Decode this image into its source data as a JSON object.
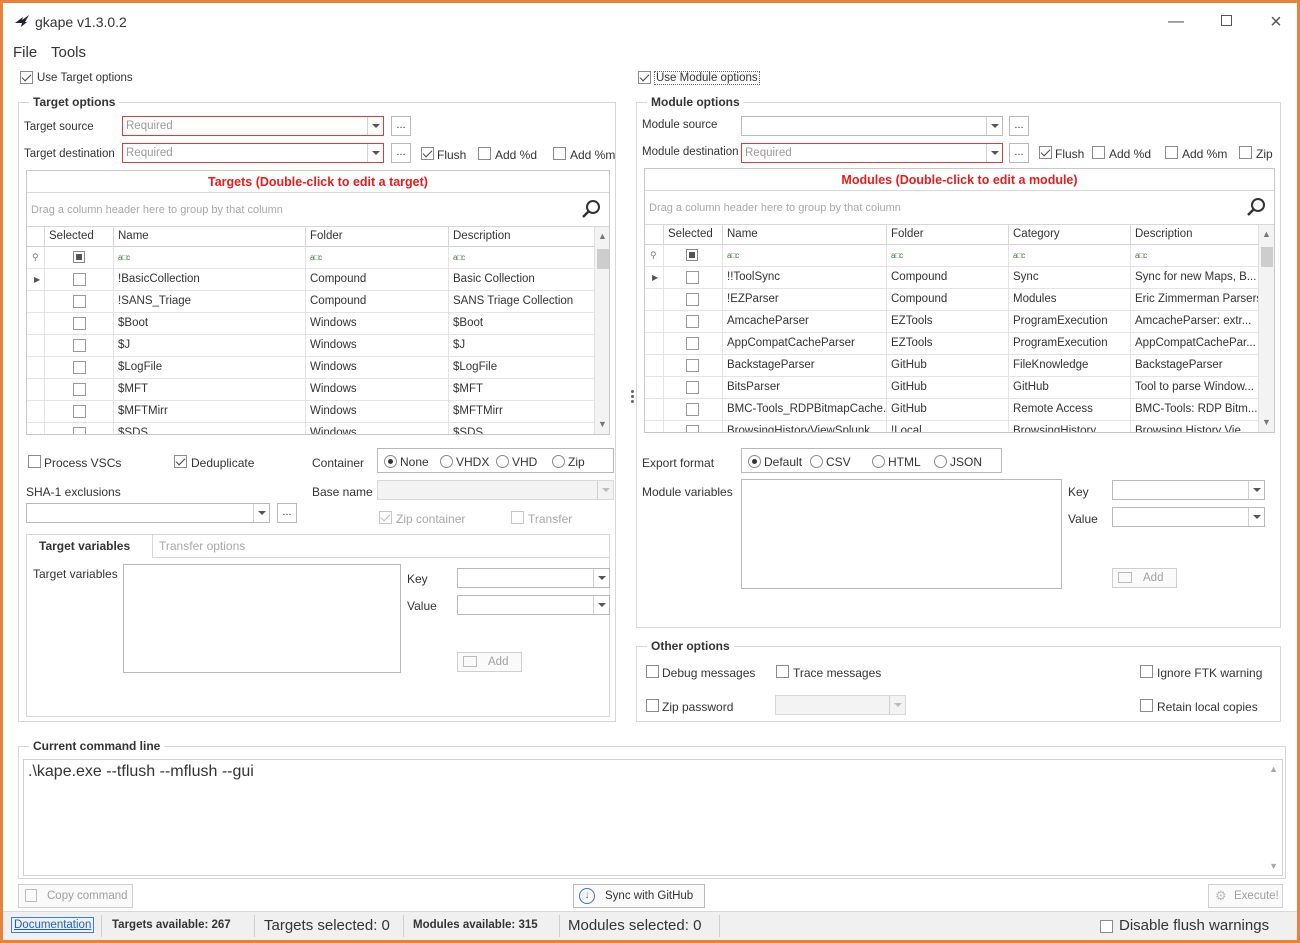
{
  "app": {
    "title": "gkape v1.3.0.2"
  },
  "menu": [
    "File",
    "Tools"
  ],
  "target": {
    "use_label": "Use Target options",
    "group_title": "Target options",
    "source_label": "Target source",
    "source_placeholder": "Required",
    "dest_label": "Target destination",
    "dest_placeholder": "Required",
    "browse": "...",
    "flush": "Flush",
    "add_d": "Add %d",
    "add_m": "Add %m",
    "grid_caption": "Targets (Double-click to edit a target)",
    "group_hint": "Drag a column header here to group by that column",
    "columns": [
      "Selected",
      "Name",
      "Folder",
      "Description"
    ],
    "filter_glyph": "a□c",
    "rows": [
      {
        "name": "!BasicCollection",
        "folder": "Compound",
        "desc": "Basic Collection"
      },
      {
        "name": "!SANS_Triage",
        "folder": "Compound",
        "desc": "SANS Triage Collection"
      },
      {
        "name": "$Boot",
        "folder": "Windows",
        "desc": "$Boot"
      },
      {
        "name": "$J",
        "folder": "Windows",
        "desc": "$J"
      },
      {
        "name": "$LogFile",
        "folder": "Windows",
        "desc": "$LogFile"
      },
      {
        "name": "$MFT",
        "folder": "Windows",
        "desc": "$MFT"
      },
      {
        "name": "$MFTMirr",
        "folder": "Windows",
        "desc": "$MFTMirr"
      },
      {
        "name": "$SDS",
        "folder": "Windows",
        "desc": "$SDS"
      }
    ],
    "process_vscs": "Process VSCs",
    "deduplicate": "Deduplicate",
    "container_label": "Container",
    "container_options": [
      "None",
      "VHDX",
      "VHD",
      "Zip"
    ],
    "sha1_label": "SHA-1 exclusions",
    "base_name_label": "Base name",
    "zip_container": "Zip container",
    "transfer": "Transfer",
    "tab_vars": "Target variables",
    "tab_transfer": "Transfer options",
    "vars_label": "Target variables",
    "key_label": "Key",
    "value_label": "Value",
    "add_button": "Add"
  },
  "module": {
    "use_label": "Use Module options",
    "group_title": "Module options",
    "source_label": "Module source",
    "dest_label": "Module destination",
    "dest_placeholder": "Required",
    "browse": "...",
    "flush": "Flush",
    "add_d": "Add %d",
    "add_m": "Add %m",
    "zip": "Zip",
    "grid_caption": "Modules (Double-click to edit a module)",
    "group_hint": "Drag a column header here to group by that column",
    "columns": [
      "Selected",
      "Name",
      "Folder",
      "Category",
      "Description"
    ],
    "filter_glyph": "a□c",
    "rows": [
      {
        "name": "!!ToolSync",
        "folder": "Compound",
        "cat": "Sync",
        "desc": "Sync for new Maps, B..."
      },
      {
        "name": "!EZParser",
        "folder": "Compound",
        "cat": "Modules",
        "desc": "Eric Zimmerman Parsers"
      },
      {
        "name": "AmcacheParser",
        "folder": "EZTools",
        "cat": "ProgramExecution",
        "desc": "AmcacheParser: extr..."
      },
      {
        "name": "AppCompatCacheParser",
        "folder": "EZTools",
        "cat": "ProgramExecution",
        "desc": "AppCompatCachePar..."
      },
      {
        "name": "BackstageParser",
        "folder": "GitHub",
        "cat": "FileKnowledge",
        "desc": "BackstageParser"
      },
      {
        "name": "BitsParser",
        "folder": "GitHub",
        "cat": "GitHub",
        "desc": "Tool to parse Window..."
      },
      {
        "name": "BMC-Tools_RDPBitmapCache...",
        "folder": "GitHub",
        "cat": "Remote Access",
        "desc": "BMC-Tools: RDP Bitm..."
      },
      {
        "name": "BrowsingHistoryViewSplunk",
        "folder": "!Local",
        "cat": "BrowsingHistory",
        "desc": "Browsing History Vie..."
      }
    ],
    "export_label": "Export format",
    "export_options": [
      "Default",
      "CSV",
      "HTML",
      "JSON"
    ],
    "vars_label": "Module variables",
    "key_label": "Key",
    "value_label": "Value",
    "add_button": "Add"
  },
  "other": {
    "group_title": "Other options",
    "debug": "Debug messages",
    "trace": "Trace messages",
    "ignore_ftk": "Ignore FTK warning",
    "zip_password": "Zip password",
    "retain": "Retain local copies"
  },
  "command": {
    "group_title": "Current command line",
    "text": ".\\kape.exe --tflush --mflush --gui",
    "copy": "Copy command",
    "sync": "Sync with GitHub",
    "execute": "Execute!"
  },
  "status": {
    "documentation": "Documentation",
    "targets_available": "Targets available: 267",
    "targets_selected": "Targets selected: 0",
    "modules_available": "Modules available: 315",
    "modules_selected": "Modules selected: 0",
    "disable_flush": "Disable flush warnings"
  }
}
